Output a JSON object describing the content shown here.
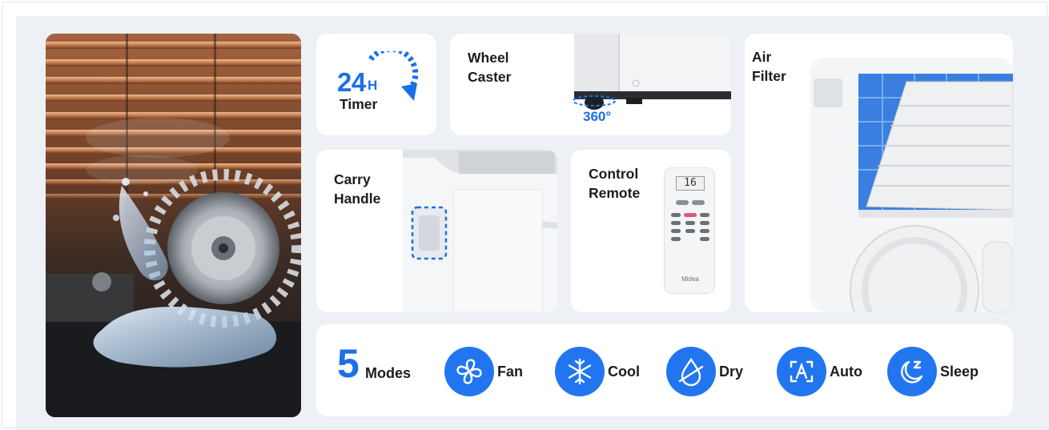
{
  "features": {
    "timer": {
      "number": "24",
      "unit": "H",
      "label": "Timer"
    },
    "wheel": {
      "title_line1": "Wheel",
      "title_line2": "Caster",
      "rotation": "360°"
    },
    "handle": {
      "title_line1": "Carry",
      "title_line2": "Handle"
    },
    "remote": {
      "title_line1": "Control",
      "title_line2": "Remote",
      "display": "16",
      "brand": "Midea"
    },
    "filter": {
      "title_line1": "Air",
      "title_line2": "Filter"
    }
  },
  "modes": {
    "count": "5",
    "label": "Modes",
    "items": [
      {
        "label": "Fan",
        "icon": "fan-icon"
      },
      {
        "label": "Cool",
        "icon": "snowflake-icon"
      },
      {
        "label": "Dry",
        "icon": "droplet-icon"
      },
      {
        "label": "Auto",
        "icon": "auto-a-icon"
      },
      {
        "label": "Sleep",
        "icon": "moon-sleep-icon"
      }
    ]
  },
  "colors": {
    "accent": "#1b6fe8",
    "icon_circle": "#2176f0",
    "panel_bg": "#edf0f4",
    "card_bg": "#ffffff"
  }
}
